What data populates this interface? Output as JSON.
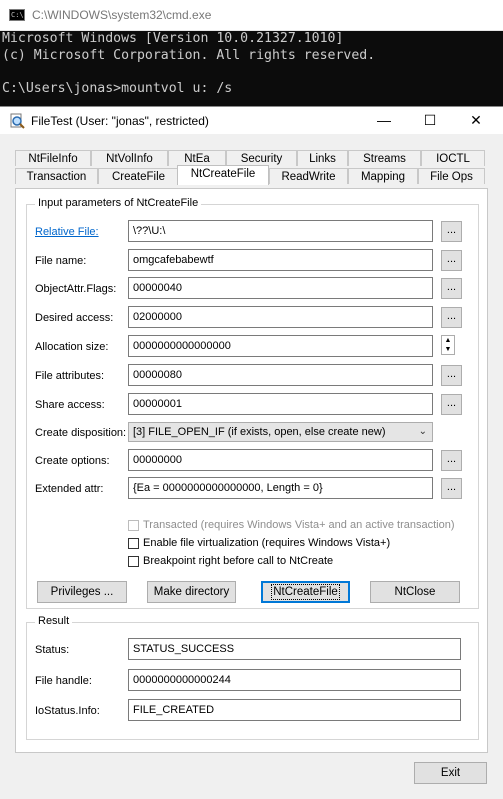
{
  "cmd": {
    "title": "C:\\WINDOWS\\system32\\cmd.exe",
    "icon_text": "C:\\",
    "lines": [
      "Microsoft Windows [Version 10.0.21327.1010]",
      "(c) Microsoft Corporation. All rights reserved.",
      "",
      "C:\\Users\\jonas>mountvol u: /s"
    ]
  },
  "dialog": {
    "title": "FileTest (User: \"jonas\", restricted)",
    "controls": {
      "minimize": "—",
      "maximize": "☐",
      "close": "✕"
    },
    "tabs_row1": [
      "NtFileInfo",
      "NtVolInfo",
      "NtEa",
      "Security",
      "Links",
      "Streams",
      "IOCTL"
    ],
    "tabs_row2": [
      "Transaction",
      "CreateFile",
      "NtCreateFile",
      "ReadWrite",
      "Mapping",
      "File Ops"
    ],
    "active_tab": "NtCreateFile",
    "input_group": {
      "label": "Input parameters of NtCreateFile",
      "relative_file": {
        "label": "Relative File:",
        "value": "\\??\\U:\\"
      },
      "file_name": {
        "label": "File name:",
        "value": "omgcafebabewtf"
      },
      "objattr_flags": {
        "label": "ObjectAttr.Flags:",
        "value": "00000040"
      },
      "desired_access": {
        "label": "Desired access:",
        "value": "02000000"
      },
      "allocation_size": {
        "label": "Allocation size:",
        "value": "0000000000000000"
      },
      "file_attributes": {
        "label": "File attributes:",
        "value": "00000080"
      },
      "share_access": {
        "label": "Share access:",
        "value": "00000001"
      },
      "create_disposition": {
        "label": "Create disposition:",
        "value": "[3] FILE_OPEN_IF (if exists, open, else create new)"
      },
      "create_options": {
        "label": "Create options:",
        "value": "00000000"
      },
      "extended_attr": {
        "label": "Extended attr:",
        "value": "{Ea = 0000000000000000, Length = 0}"
      },
      "dots": "...",
      "checkboxes": {
        "transacted": "Transacted (requires Windows Vista+ and an active transaction)",
        "virtualization": "Enable file virtualization (requires Windows Vista+)",
        "breakpoint": "Breakpoint right before call to NtCreate"
      }
    },
    "buttons": {
      "privileges": "Privileges ...",
      "make_directory": "Make directory",
      "ntcreatefile": "NtCreateFile",
      "ntclose": "NtClose",
      "exit": "Exit"
    },
    "result_group": {
      "label": "Result",
      "status": {
        "label": "Status:",
        "value": "STATUS_SUCCESS"
      },
      "file_handle": {
        "label": "File handle:",
        "value": "0000000000000244"
      },
      "iostatus": {
        "label": "IoStatus.Info:",
        "value": "FILE_CREATED"
      }
    }
  }
}
